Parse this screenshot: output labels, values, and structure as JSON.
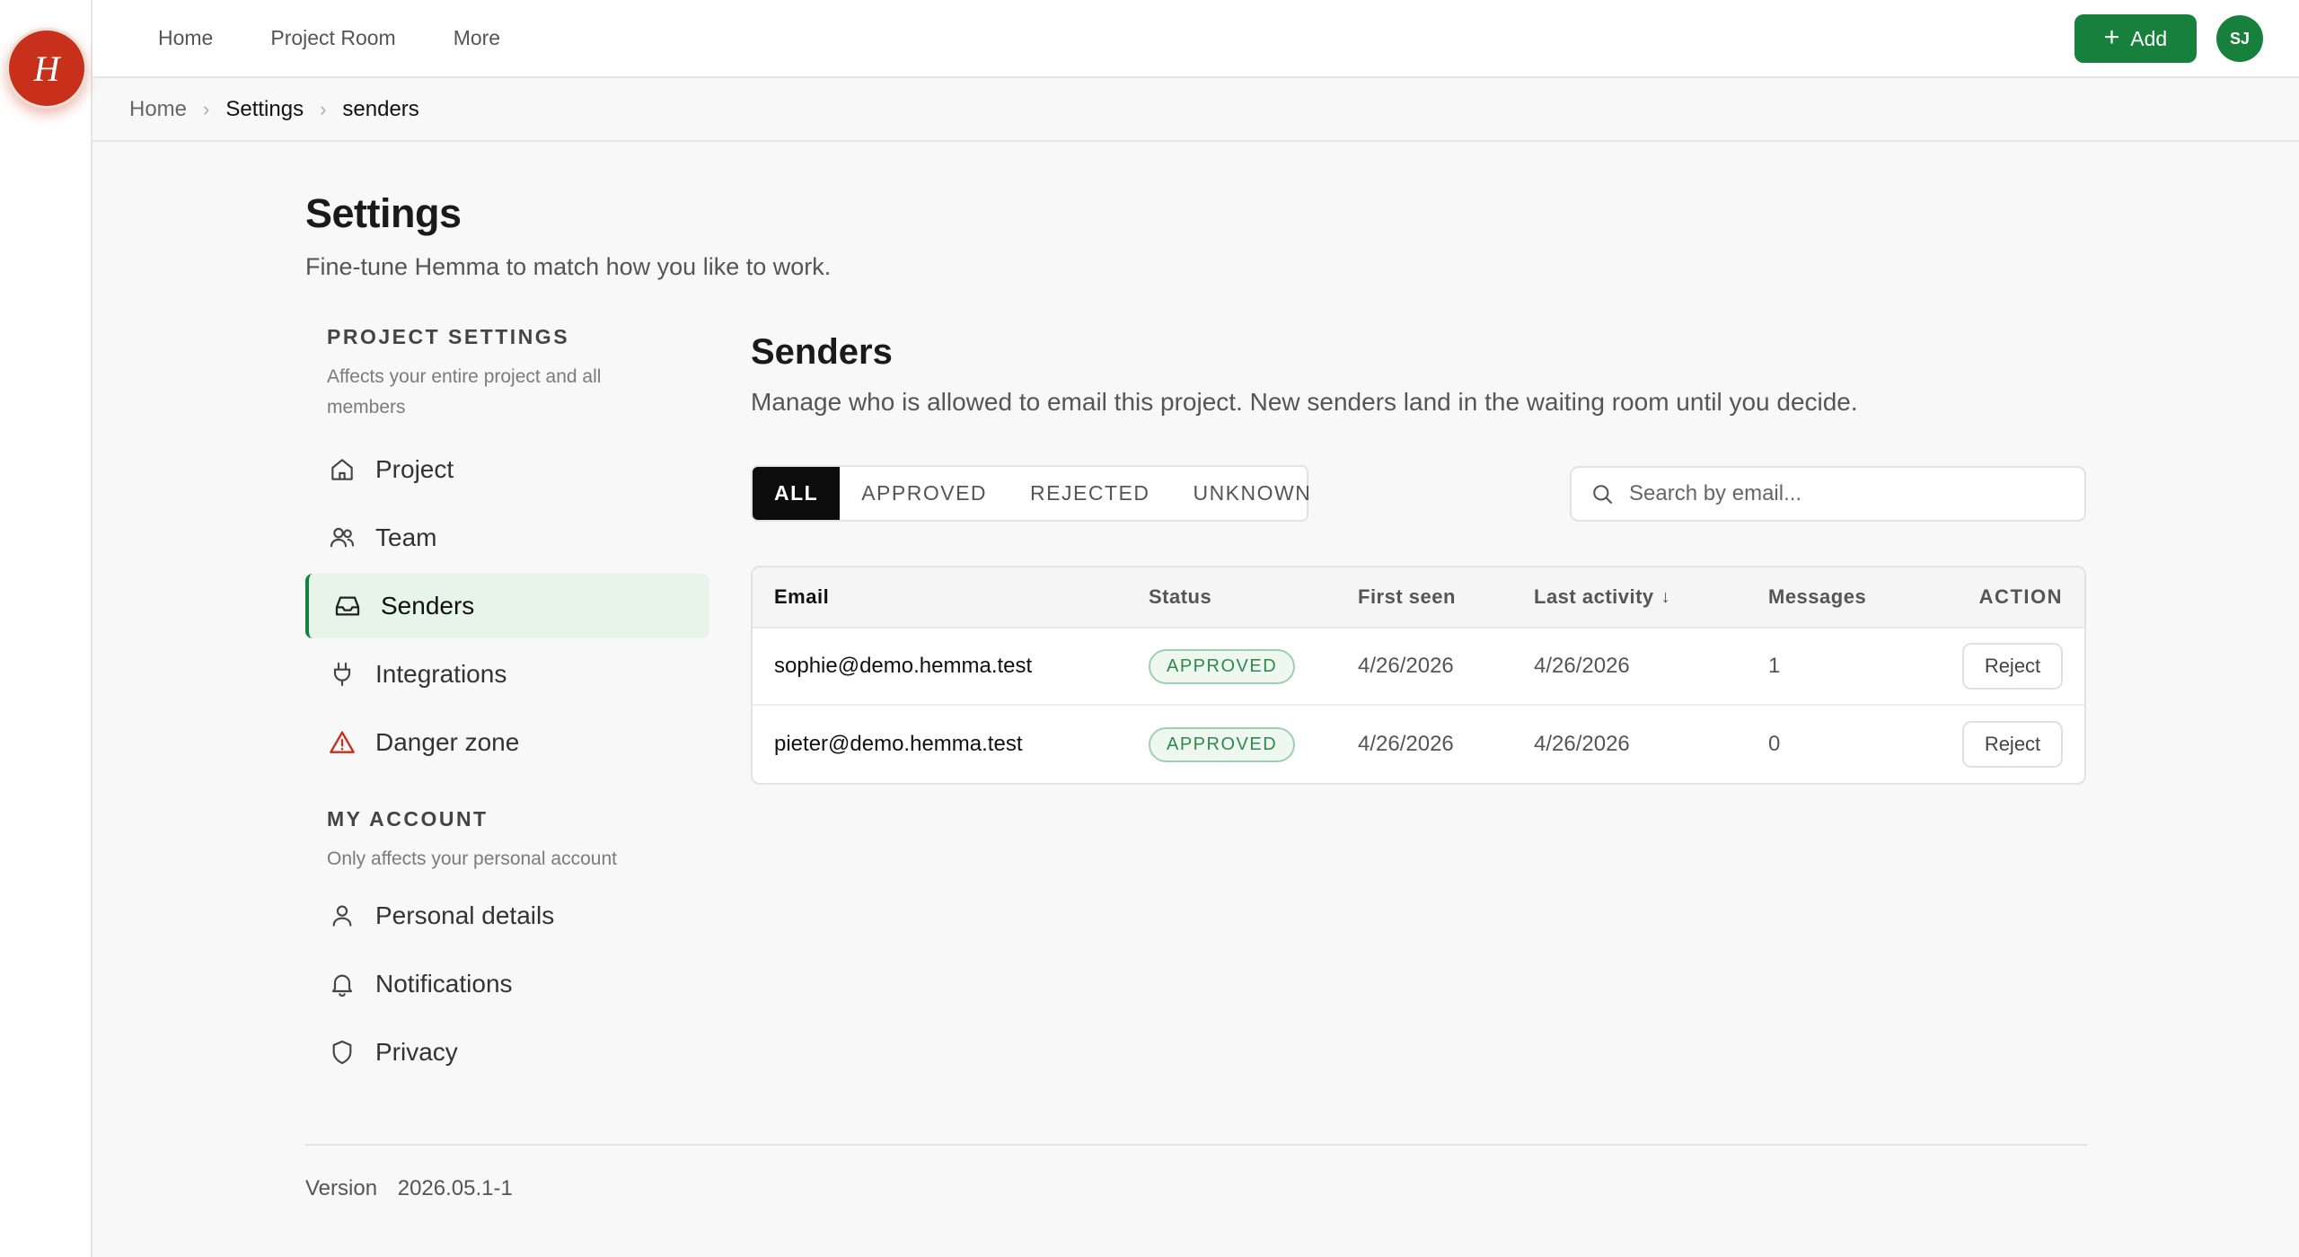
{
  "app": {
    "logo_letter": "H"
  },
  "topnav": {
    "items": [
      "Home",
      "Project Room",
      "More"
    ],
    "add_label": "Add",
    "avatar_initials": "SJ"
  },
  "breadcrumb": {
    "items": [
      "Home",
      "Settings",
      "senders"
    ]
  },
  "page": {
    "title": "Settings",
    "subtitle": "Fine-tune Hemma to match how you like to work."
  },
  "sidebar": {
    "project_section": {
      "heading": "PROJECT SETTINGS",
      "description": "Affects your entire project and all members",
      "items": [
        {
          "label": "Project",
          "icon": "home-icon"
        },
        {
          "label": "Team",
          "icon": "users-icon"
        },
        {
          "label": "Senders",
          "icon": "inbox-icon",
          "active": true
        },
        {
          "label": "Integrations",
          "icon": "plug-icon"
        },
        {
          "label": "Danger zone",
          "icon": "warning-icon"
        }
      ]
    },
    "account_section": {
      "heading": "MY ACCOUNT",
      "description": "Only affects your personal account",
      "items": [
        {
          "label": "Personal details",
          "icon": "user-icon"
        },
        {
          "label": "Notifications",
          "icon": "bell-icon"
        },
        {
          "label": "Privacy",
          "icon": "shield-icon"
        }
      ]
    }
  },
  "senders": {
    "title": "Senders",
    "description": "Manage who is allowed to email this project. New senders land in the waiting room until you decide.",
    "filters": [
      "ALL",
      "APPROVED",
      "REJECTED",
      "UNKNOWN"
    ],
    "active_filter": "ALL",
    "search_placeholder": "Search by email...",
    "columns": [
      "Email",
      "Status",
      "First seen",
      "Last activity",
      "Messages",
      "ACTION"
    ],
    "sort_column": "Last activity",
    "sort_direction": "descending",
    "rows": [
      {
        "email": "sophie@demo.hemma.test",
        "status": "APPROVED",
        "first_seen": "4/26/2026",
        "last_activity": "4/26/2026",
        "messages": "1",
        "action": "Reject"
      },
      {
        "email": "pieter@demo.hemma.test",
        "status": "APPROVED",
        "first_seen": "4/26/2026",
        "last_activity": "4/26/2026",
        "messages": "0",
        "action": "Reject"
      }
    ]
  },
  "footer": {
    "version_label": "Version",
    "version_value": "2026.05.1-1"
  },
  "colors": {
    "accent": "#16803c",
    "danger": "#c8301b",
    "logo": "#c8301b"
  }
}
